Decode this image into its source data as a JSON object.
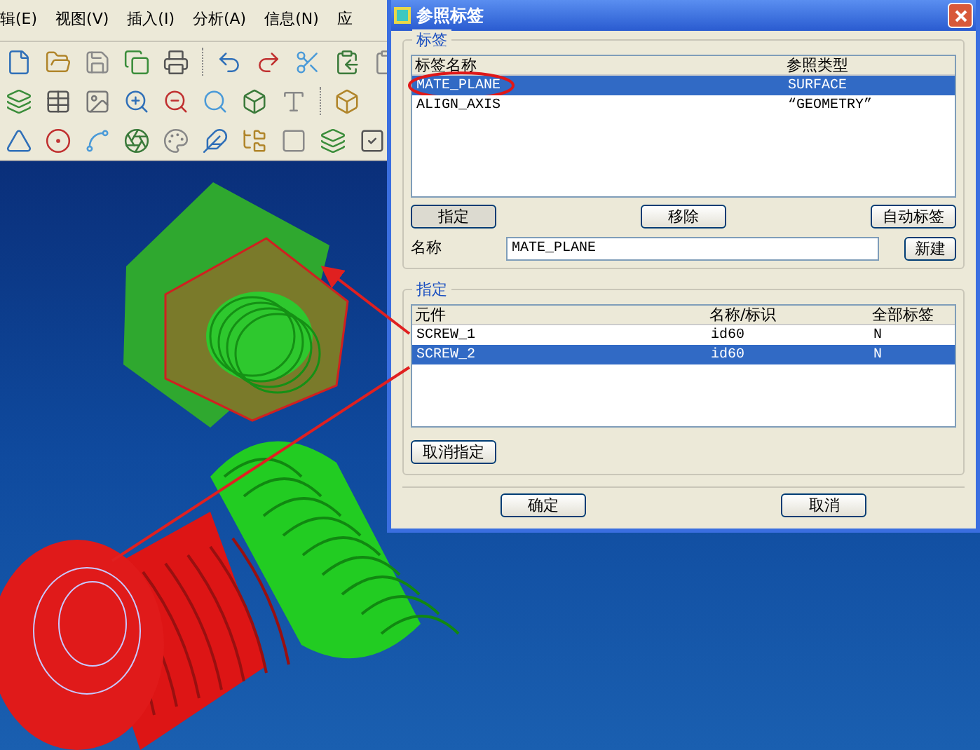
{
  "menu": [
    "辑(E)",
    "视图(V)",
    "插入(I)",
    "分析(A)",
    "信息(N)",
    "应"
  ],
  "dialog": {
    "title": "参照标签",
    "tags_group": {
      "label": "标签",
      "columns": [
        "标签名称",
        "参照类型"
      ],
      "rows": [
        {
          "cells": [
            "MATE_PLANE",
            "SURFACE"
          ],
          "selected": true,
          "circled": true
        },
        {
          "cells": [
            "ALIGN_AXIS",
            "“GEOMETRY”"
          ],
          "selected": false,
          "circled": false
        }
      ],
      "buttons": [
        "指定",
        "移除",
        "自动标签"
      ],
      "name_label": "名称",
      "name_value": "MATE_PLANE",
      "new_button": "新建"
    },
    "assign_group": {
      "label": "指定",
      "columns": [
        "元件",
        "名称/标识",
        "全部标签"
      ],
      "rows": [
        {
          "cells": [
            "SCREW_1",
            "id60",
            "N"
          ],
          "selected": false
        },
        {
          "cells": [
            "SCREW_2",
            "id60",
            "N"
          ],
          "selected": true
        }
      ],
      "unassign_button": "取消指定"
    },
    "buttons": [
      "确定",
      "取消"
    ]
  }
}
